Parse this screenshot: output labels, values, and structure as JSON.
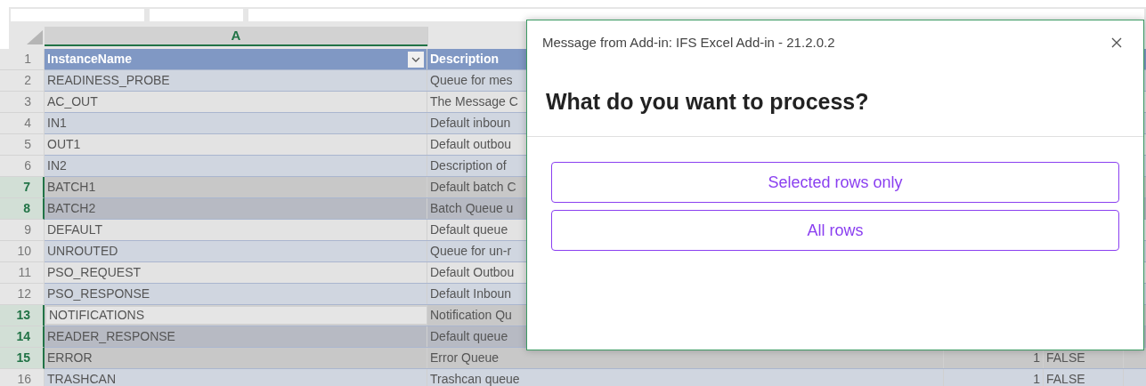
{
  "sheet": {
    "column_headers": [
      {
        "label": "A",
        "selected": true
      }
    ],
    "rows": [
      {
        "number": "1",
        "kind": "header",
        "selected": false,
        "active": false,
        "instance": "InstanceName",
        "description": "Description"
      },
      {
        "number": "2",
        "kind": "data",
        "selected": false,
        "active": false,
        "instance": "READINESS_PROBE",
        "description": "Queue for mes"
      },
      {
        "number": "3",
        "kind": "data",
        "selected": false,
        "active": false,
        "instance": "AC_OUT",
        "description": "The Message C"
      },
      {
        "number": "4",
        "kind": "data",
        "selected": false,
        "active": false,
        "instance": "IN1",
        "description": "Default inboun"
      },
      {
        "number": "5",
        "kind": "data",
        "selected": false,
        "active": false,
        "instance": "OUT1",
        "description": "Default outbou"
      },
      {
        "number": "6",
        "kind": "data",
        "selected": false,
        "active": false,
        "instance": "IN2",
        "description": "Description of"
      },
      {
        "number": "7",
        "kind": "data",
        "selected": true,
        "active": false,
        "instance": "BATCH1",
        "description": "Default batch C"
      },
      {
        "number": "8",
        "kind": "data",
        "selected": true,
        "active": false,
        "instance": "BATCH2",
        "description": "Batch Queue u"
      },
      {
        "number": "9",
        "kind": "data",
        "selected": false,
        "active": false,
        "instance": "DEFAULT",
        "description": "Default queue"
      },
      {
        "number": "10",
        "kind": "data",
        "selected": false,
        "active": false,
        "instance": "UNROUTED",
        "description": "Queue for un-r"
      },
      {
        "number": "11",
        "kind": "data",
        "selected": false,
        "active": false,
        "instance": "PSO_REQUEST",
        "description": "Default Outbou"
      },
      {
        "number": "12",
        "kind": "data",
        "selected": false,
        "active": false,
        "instance": "PSO_RESPONSE",
        "description": "Default Inboun"
      },
      {
        "number": "13",
        "kind": "data",
        "selected": true,
        "active": true,
        "instance": "NOTIFICATIONS",
        "description": "Notification Qu"
      },
      {
        "number": "14",
        "kind": "data",
        "selected": true,
        "active": false,
        "instance": "READER_RESPONSE",
        "description": "Default queue"
      },
      {
        "number": "15",
        "kind": "data",
        "selected": true,
        "active": false,
        "instance": "ERROR",
        "description": "Error Queue",
        "column_3": "1",
        "column_4": "FALSE"
      },
      {
        "number": "16",
        "kind": "data",
        "selected": false,
        "active": false,
        "instance": "TRASHCAN",
        "description": "Trashcan queue",
        "column_3": "1",
        "column_4": "FALSE"
      }
    ]
  },
  "dialog": {
    "title": "Message from Add-in: IFS Excel Add-in - 21.2.0.2",
    "heading": "What do you want to process?",
    "options": [
      "Selected rows only",
      "All rows"
    ]
  }
}
